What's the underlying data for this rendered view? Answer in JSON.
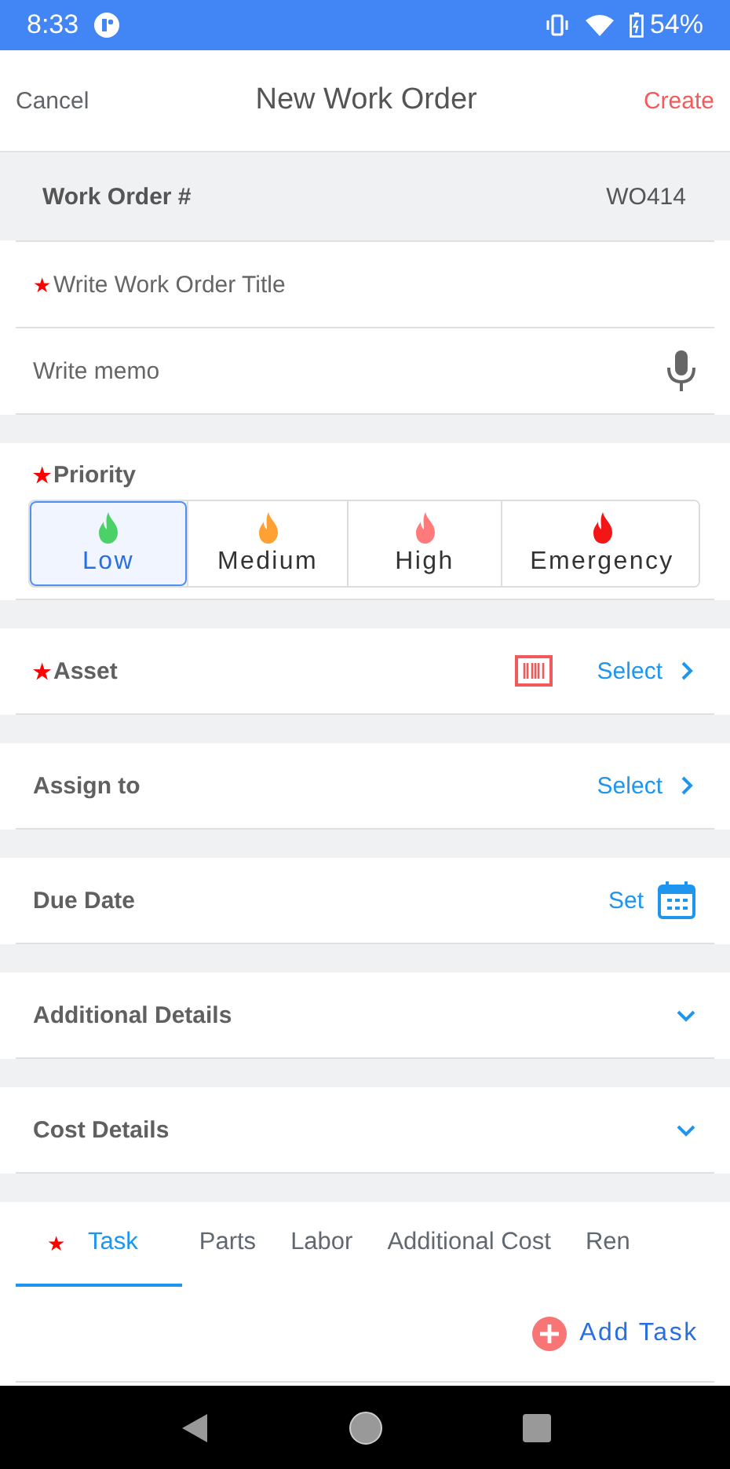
{
  "status_bar": {
    "time": "8:33",
    "battery": "54%"
  },
  "header": {
    "cancel": "Cancel",
    "title": "New Work Order",
    "create": "Create"
  },
  "work_order": {
    "label": "Work Order #",
    "value": "WO414"
  },
  "title_field": {
    "placeholder": "Write Work Order Title",
    "marker": "★"
  },
  "memo_field": {
    "placeholder": "Write memo"
  },
  "priority": {
    "label": "Priority",
    "marker": "★",
    "options": [
      {
        "label": "Low",
        "color": "#4cd068",
        "selected": true
      },
      {
        "label": "Medium",
        "color": "#ffa033",
        "selected": false
      },
      {
        "label": "High",
        "color": "#ff7a7a",
        "selected": false
      },
      {
        "label": "Emergency",
        "color": "#f31616",
        "selected": false
      }
    ]
  },
  "rows": [
    {
      "kind": "scan_select",
      "label": "Asset",
      "marker": "★",
      "action": "Select"
    },
    {
      "kind": "select",
      "label": "Assign to",
      "action": "Select"
    },
    {
      "kind": "date",
      "label": "Due Date",
      "action": "Set"
    },
    {
      "kind": "expand",
      "label": "Additional Details"
    },
    {
      "kind": "expand",
      "label": "Cost Details"
    }
  ],
  "tabs": [
    {
      "label": "Task",
      "marker": "★",
      "selected": true
    },
    {
      "label": "Parts",
      "selected": false
    },
    {
      "label": "Labor",
      "selected": false
    },
    {
      "label": "Additional Cost",
      "selected": false
    },
    {
      "label": "Ren",
      "selected": false
    }
  ],
  "add_task": "Add Task"
}
